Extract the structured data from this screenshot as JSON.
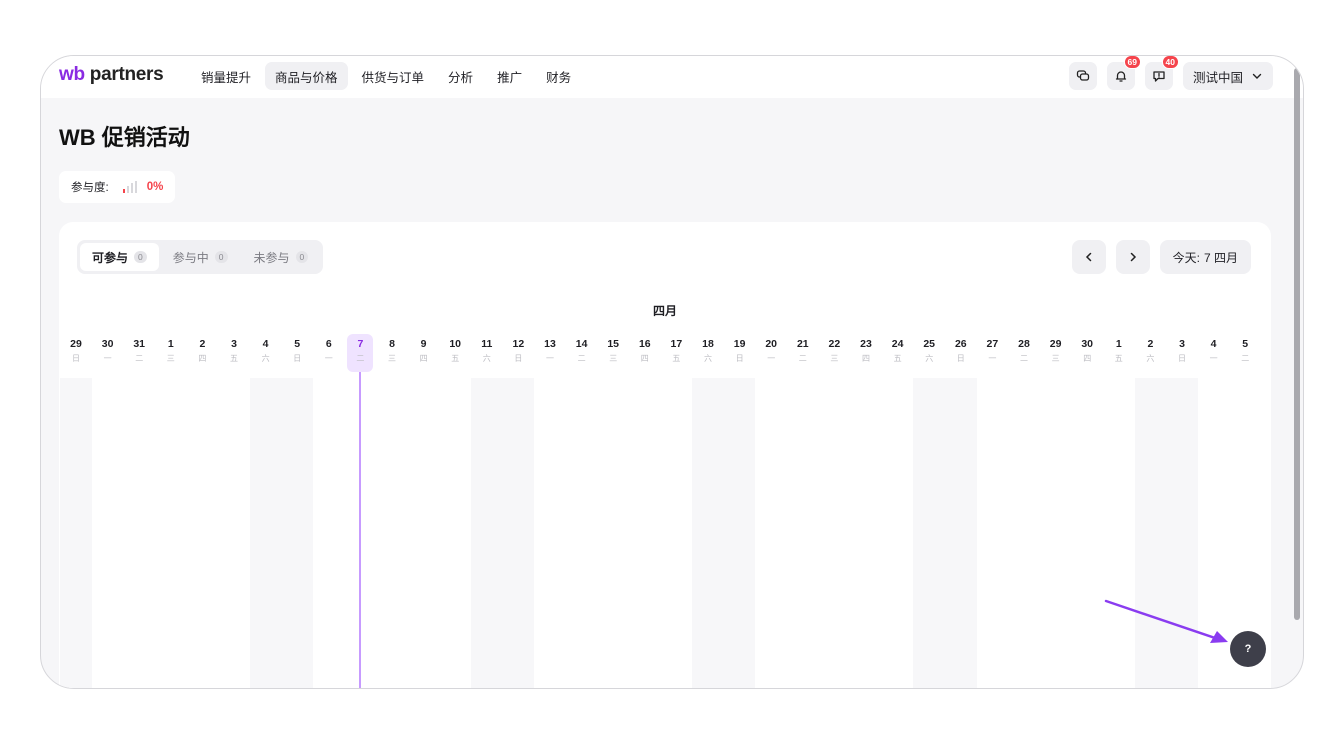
{
  "brand": {
    "logo_wb": "wb",
    "logo_rest": " partners",
    "accent": "#8a2be2"
  },
  "nav": {
    "items": [
      "销量提升",
      "商品与价格",
      "供货与订单",
      "分析",
      "推广",
      "财务"
    ],
    "active_index": 1
  },
  "header_right": {
    "chat_icon": "chat-icon",
    "notifications_badge": "69",
    "news_badge": "40",
    "account_label": "测试中国"
  },
  "page": {
    "title": "WB 促销活动",
    "participation_label": "参与度:",
    "participation_value": "0%"
  },
  "tabs": [
    {
      "label": "可参与",
      "count": "0",
      "active": true
    },
    {
      "label": "参与中",
      "count": "0",
      "active": false
    },
    {
      "label": "未参与",
      "count": "0",
      "active": false
    }
  ],
  "calendar": {
    "month": "四月",
    "today_label": "今天:",
    "today_value": "7 四月",
    "today_index": 9,
    "days": [
      {
        "d": "29",
        "w": "日"
      },
      {
        "d": "30",
        "w": "一"
      },
      {
        "d": "31",
        "w": "二"
      },
      {
        "d": "1",
        "w": "三"
      },
      {
        "d": "2",
        "w": "四"
      },
      {
        "d": "3",
        "w": "五"
      },
      {
        "d": "4",
        "w": "六"
      },
      {
        "d": "5",
        "w": "日"
      },
      {
        "d": "6",
        "w": "一"
      },
      {
        "d": "7",
        "w": "二"
      },
      {
        "d": "8",
        "w": "三"
      },
      {
        "d": "9",
        "w": "四"
      },
      {
        "d": "10",
        "w": "五"
      },
      {
        "d": "11",
        "w": "六"
      },
      {
        "d": "12",
        "w": "日"
      },
      {
        "d": "13",
        "w": "一"
      },
      {
        "d": "14",
        "w": "二"
      },
      {
        "d": "15",
        "w": "三"
      },
      {
        "d": "16",
        "w": "四"
      },
      {
        "d": "17",
        "w": "五"
      },
      {
        "d": "18",
        "w": "六"
      },
      {
        "d": "19",
        "w": "日"
      },
      {
        "d": "20",
        "w": "一"
      },
      {
        "d": "21",
        "w": "二"
      },
      {
        "d": "22",
        "w": "三"
      },
      {
        "d": "23",
        "w": "四"
      },
      {
        "d": "24",
        "w": "五"
      },
      {
        "d": "25",
        "w": "六"
      },
      {
        "d": "26",
        "w": "日"
      },
      {
        "d": "27",
        "w": "一"
      },
      {
        "d": "28",
        "w": "二"
      },
      {
        "d": "29",
        "w": "三"
      },
      {
        "d": "30",
        "w": "四"
      },
      {
        "d": "1",
        "w": "五"
      },
      {
        "d": "2",
        "w": "六"
      },
      {
        "d": "3",
        "w": "日"
      },
      {
        "d": "4",
        "w": "一"
      },
      {
        "d": "5",
        "w": "二"
      }
    ]
  },
  "help": {
    "label": "?"
  },
  "colors": {
    "badge": "#f5444c",
    "today_highlight": "#efe3ff",
    "annotation_arrow": "#8a3cf0"
  }
}
